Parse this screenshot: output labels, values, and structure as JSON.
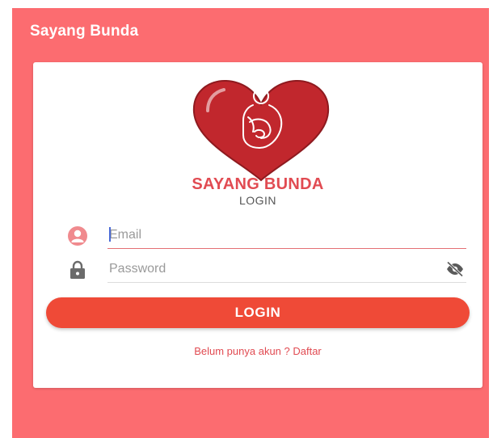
{
  "app_bar": {
    "title": "Sayang Bunda"
  },
  "logo": {
    "icon": "heart-pregnant-mother-icon",
    "heart_color": "#c1272d",
    "outline_color": "#ffffff"
  },
  "brand": {
    "name": "SAYANG BUNDA",
    "subtitle": "LOGIN"
  },
  "form": {
    "email": {
      "placeholder": "Email",
      "value": "",
      "icon": "user-icon",
      "icon_color": "#f08a8e"
    },
    "password": {
      "placeholder": "Password",
      "value": "",
      "icon": "lock-icon",
      "icon_color": "#6b6b6b",
      "toggle_icon": "eye-off-icon"
    },
    "login_label": "LOGIN",
    "register_text": "Belum punya akun ? Daftar"
  },
  "colors": {
    "background": "#fc6c70",
    "card": "#ffffff",
    "accent": "#e14b52",
    "button": "#ef4a37"
  }
}
